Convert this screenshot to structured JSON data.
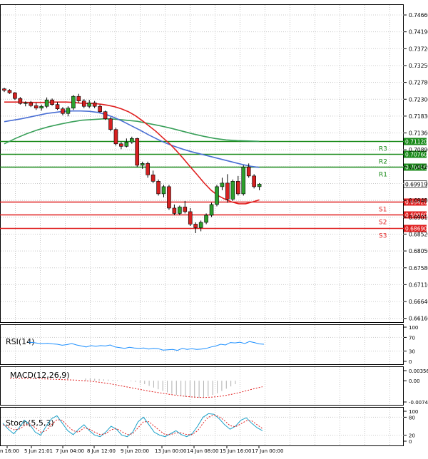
{
  "chart_data": {
    "type": "candlestick",
    "instrument_note": "",
    "main_panel": {
      "price_axis_ticks": [
        "0.74660",
        "0.74190",
        "0.73720",
        "0.73250",
        "0.72780",
        "0.72300",
        "0.71830",
        "0.71360",
        "0.70890",
        "0.70420",
        "0.69950",
        "0.69480",
        "0.69010",
        "0.68520",
        "0.68050",
        "0.67580",
        "0.67110",
        "0.66640",
        "0.66160"
      ],
      "ylim": [
        0.6616,
        0.7505
      ],
      "current_price": "0.69919",
      "levels": [
        {
          "name": "R3",
          "value": 0.7112,
          "label": "0.71120",
          "color": "#1a8a1a"
        },
        {
          "name": "R2",
          "value": 0.7076,
          "label": "0.70760",
          "color": "#1a8a1a"
        },
        {
          "name": "R1",
          "value": 0.704,
          "label": "0.70400",
          "color": "#1a8a1a"
        },
        {
          "name": "S1",
          "value": 0.6942,
          "label": "0.69420",
          "color": "#e02020"
        },
        {
          "name": "S2",
          "value": 0.6906,
          "label": "0.69060",
          "color": "#e02020"
        },
        {
          "name": "S3",
          "value": 0.6869,
          "label": "0.68690",
          "color": "#e02020"
        }
      ],
      "candles": [
        [
          0.7259,
          0.7262,
          0.725,
          0.7255
        ],
        [
          0.7255,
          0.7258,
          0.7245,
          0.7248
        ],
        [
          0.7248,
          0.725,
          0.7228,
          0.7232
        ],
        [
          0.7232,
          0.7236,
          0.7215,
          0.7218
        ],
        [
          0.7218,
          0.7224,
          0.721,
          0.722
        ],
        [
          0.722,
          0.7225,
          0.7208,
          0.7212
        ],
        [
          0.7212,
          0.722,
          0.72,
          0.7205
        ],
        [
          0.7205,
          0.7215,
          0.7198,
          0.721
        ],
        [
          0.721,
          0.7235,
          0.7205,
          0.7228
        ],
        [
          0.7228,
          0.7232,
          0.7212,
          0.7215
        ],
        [
          0.7215,
          0.7222,
          0.72,
          0.7203
        ],
        [
          0.7203,
          0.7208,
          0.7185,
          0.719
        ],
        [
          0.719,
          0.721,
          0.7182,
          0.7205
        ],
        [
          0.7205,
          0.7242,
          0.72,
          0.7238
        ],
        [
          0.7238,
          0.7245,
          0.722,
          0.7225
        ],
        [
          0.7225,
          0.723,
          0.7205,
          0.721
        ],
        [
          0.721,
          0.7228,
          0.7205,
          0.722
        ],
        [
          0.722,
          0.7225,
          0.7205,
          0.721
        ],
        [
          0.721,
          0.7215,
          0.7192,
          0.7195
        ],
        [
          0.7195,
          0.7198,
          0.7172,
          0.7175
        ],
        [
          0.7175,
          0.718,
          0.714,
          0.7145
        ],
        [
          0.7145,
          0.715,
          0.71,
          0.7105
        ],
        [
          0.7105,
          0.711,
          0.709,
          0.7098
        ],
        [
          0.7098,
          0.712,
          0.7095,
          0.711
        ],
        [
          0.711,
          0.7125,
          0.7105,
          0.712
        ],
        [
          0.712,
          0.7122,
          0.704,
          0.7045
        ],
        [
          0.7045,
          0.7055,
          0.7035,
          0.705
        ],
        [
          0.705,
          0.7055,
          0.701,
          0.7018
        ],
        [
          0.7018,
          0.703,
          0.6995,
          0.7
        ],
        [
          0.7,
          0.7005,
          0.696,
          0.6965
        ],
        [
          0.6965,
          0.699,
          0.6955,
          0.6985
        ],
        [
          0.6985,
          0.699,
          0.692,
          0.6925
        ],
        [
          0.6925,
          0.6935,
          0.6905,
          0.691
        ],
        [
          0.691,
          0.6932,
          0.6905,
          0.6928
        ],
        [
          0.6928,
          0.6945,
          0.691,
          0.6915
        ],
        [
          0.6915,
          0.6925,
          0.6875,
          0.688
        ],
        [
          0.688,
          0.6885,
          0.6855,
          0.687
        ],
        [
          0.687,
          0.689,
          0.686,
          0.6885
        ],
        [
          0.6885,
          0.691,
          0.688,
          0.6905
        ],
        [
          0.6905,
          0.694,
          0.69,
          0.6935
        ],
        [
          0.6935,
          0.699,
          0.693,
          0.6985
        ],
        [
          0.6985,
          0.701,
          0.6975,
          0.6995
        ],
        [
          0.6995,
          0.702,
          0.694,
          0.695
        ],
        [
          0.695,
          0.7005,
          0.6945,
          0.7
        ],
        [
          0.7,
          0.7015,
          0.696,
          0.6965
        ],
        [
          0.6965,
          0.7045,
          0.696,
          0.704
        ],
        [
          0.704,
          0.705,
          0.701,
          0.7015
        ],
        [
          0.7015,
          0.702,
          0.698,
          0.6985
        ],
        [
          0.6985,
          0.6995,
          0.6975,
          0.6992
        ]
      ],
      "ma_red": [
        0.7222,
        0.7222,
        0.7222,
        0.7221,
        0.7221,
        0.7221,
        0.7221,
        0.7222,
        0.7222,
        0.7222,
        0.7221,
        0.7219,
        0.7218,
        0.7218,
        0.7216,
        0.7213,
        0.7209,
        0.7203,
        0.7195,
        0.7184,
        0.717,
        0.7155,
        0.714,
        0.7122,
        0.7105,
        0.7085,
        0.7063,
        0.704,
        0.7018,
        0.6995,
        0.6975,
        0.696,
        0.695,
        0.6942,
        0.6937,
        0.6937,
        0.6942,
        0.6948
      ],
      "ma_blue": [
        0.7167,
        0.7171,
        0.7175,
        0.718,
        0.7185,
        0.719,
        0.7193,
        0.7196,
        0.7197,
        0.7197,
        0.7196,
        0.7193,
        0.7187,
        0.7178,
        0.7167,
        0.7155,
        0.7143,
        0.713,
        0.7118,
        0.7107,
        0.7098,
        0.709,
        0.7083,
        0.7077,
        0.7071,
        0.7065,
        0.7059,
        0.7053,
        0.7047,
        0.7042,
        0.7039
      ],
      "ma_green": [
        0.7105,
        0.712,
        0.7133,
        0.7144,
        0.7153,
        0.716,
        0.7166,
        0.7171,
        0.7173,
        0.7175,
        0.7174,
        0.7171,
        0.7168,
        0.7162,
        0.7156,
        0.7149,
        0.7141,
        0.7133,
        0.7126,
        0.712,
        0.7116,
        0.7114,
        0.7113,
        0.7112
      ]
    },
    "x_axis_labels": [
      "n 16:00",
      "5 Jun 21:01",
      "7 Jun 04:00",
      "8 Jun 12:00",
      "9 Jun 20:00",
      "13 Jun 00:00",
      "14 Jun 08:00",
      "15 Jun 16:00",
      "17 Jun 00:00"
    ],
    "rsi": {
      "label": "RSI(14)",
      "ticks": [
        "100",
        "70",
        "30",
        "0"
      ],
      "values": [
        56,
        55,
        53,
        52,
        53,
        51,
        50,
        47,
        49,
        52,
        48,
        45,
        42,
        46,
        44,
        46,
        45,
        48,
        42,
        40,
        38,
        41,
        39,
        38,
        39,
        36,
        38,
        37,
        33,
        34,
        35,
        32,
        38,
        35,
        37,
        35,
        36,
        38,
        42,
        45,
        50,
        48,
        55,
        54,
        56,
        52,
        58,
        55,
        51,
        50
      ]
    },
    "macd": {
      "label": "MACD(12,26,9)",
      "ticks": [
        "0.003565",
        "0.00",
        "-0.007482"
      ],
      "histogram": [
        0.0008,
        0.0008,
        0.0007,
        0.0006,
        0.0005,
        0.0004,
        0.0003,
        0.0002,
        0.0001,
        0.0,
        -0.0002,
        -0.0004,
        -0.0008,
        -0.0012,
        -0.0018,
        -0.0024,
        -0.003,
        -0.0036,
        -0.0041,
        -0.0046,
        -0.005,
        -0.0054,
        -0.0057,
        -0.0059,
        -0.006,
        -0.006,
        -0.0058,
        -0.0055,
        -0.005,
        -0.0044,
        -0.0036,
        -0.0028,
        -0.002,
        -0.0012
      ],
      "signal": [
        0.0009,
        0.0009,
        0.0008,
        0.0008,
        0.0007,
        0.0006,
        0.0005,
        0.0004,
        0.0003,
        0.0002,
        0.0,
        -0.0002,
        -0.0005,
        -0.0009,
        -0.0013,
        -0.0018,
        -0.0023,
        -0.0028,
        -0.0033,
        -0.0038,
        -0.0042,
        -0.0046,
        -0.005,
        -0.0053,
        -0.0056,
        -0.0058,
        -0.0059,
        -0.0058,
        -0.0056,
        -0.0052,
        -0.0047,
        -0.0041,
        -0.0034,
        -0.0027,
        -0.0021
      ]
    },
    "stoch": {
      "label": "Stoch(5,5,3)",
      "ticks": [
        "100",
        "80",
        "20",
        "0"
      ],
      "k": [
        60,
        40,
        25,
        45,
        70,
        55,
        30,
        20,
        50,
        75,
        85,
        60,
        35,
        22,
        40,
        55,
        35,
        20,
        15,
        30,
        50,
        40,
        20,
        15,
        30,
        65,
        80,
        55,
        30,
        20,
        15,
        25,
        35,
        22,
        15,
        25,
        50,
        80,
        92,
        90,
        75,
        55,
        40,
        50,
        70,
        78,
        60,
        45,
        35
      ],
      "d": [
        55,
        48,
        38,
        40,
        52,
        58,
        45,
        30,
        35,
        55,
        72,
        70,
        50,
        35,
        30,
        45,
        40,
        30,
        22,
        25,
        38,
        42,
        32,
        22,
        25,
        45,
        65,
        65,
        50,
        35,
        22,
        22,
        28,
        28,
        22,
        22,
        35,
        60,
        80,
        88,
        82,
        68,
        52,
        48,
        58,
        68,
        68,
        55,
        42
      ]
    }
  }
}
